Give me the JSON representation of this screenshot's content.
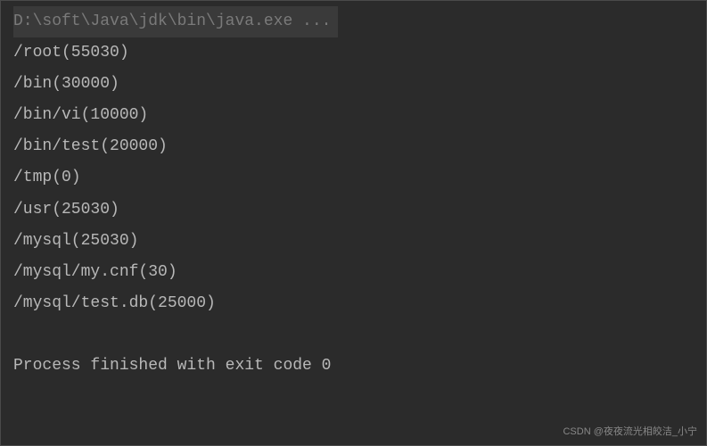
{
  "console": {
    "header": "D:\\soft\\Java\\jdk\\bin\\java.exe ...",
    "lines": [
      "/root(55030)",
      "/bin(30000)",
      "/bin/vi(10000)",
      "/bin/test(20000)",
      "/tmp(0)",
      "/usr(25030)",
      "/mysql(25030)",
      "/mysql/my.cnf(30)",
      "/mysql/test.db(25000)",
      "",
      "Process finished with exit code 0"
    ]
  },
  "watermark": "CSDN @夜夜流光相皎洁_小宁"
}
